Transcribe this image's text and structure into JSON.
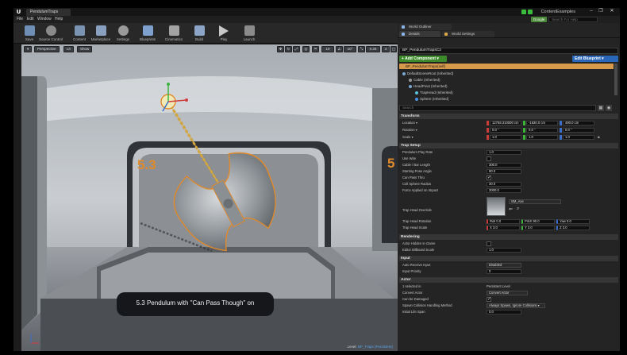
{
  "window": {
    "tab_label": "PendulumTraps",
    "project_name": "ContentExamples",
    "min": "–",
    "max": "❐",
    "close": "✕"
  },
  "menu": [
    "File",
    "Edit",
    "Window",
    "Help"
  ],
  "google_badge": "Google",
  "help_search_placeholder": "Search For Help",
  "toolbar": [
    {
      "label": "Save",
      "icon": "save-icon",
      "color": "#6f8fb7"
    },
    {
      "label": "Source Control",
      "icon": "source-control-icon",
      "color": "#8a8a8a"
    },
    {
      "label": "Content",
      "icon": "content-icon",
      "color": "#7b93b3"
    },
    {
      "label": "Marketplace",
      "icon": "marketplace-icon",
      "color": "#8aa0c0"
    },
    {
      "label": "Settings",
      "icon": "settings-icon",
      "color": "#9a9a9a"
    },
    {
      "label": "Blueprints",
      "icon": "blueprints-icon",
      "color": "#7da1cc"
    },
    {
      "label": "Cinematics",
      "icon": "cinematics-icon",
      "color": "#a3a3a3"
    },
    {
      "label": "Build",
      "icon": "build-icon",
      "color": "#8ca4c6"
    },
    {
      "label": "Play",
      "icon": "play-icon",
      "color": "#c8c8c8"
    },
    {
      "label": "Launch",
      "icon": "launch-icon",
      "color": "#8b8b8b"
    }
  ],
  "viewport": {
    "menu_button": "▾",
    "perspective": "Perspective",
    "lit": "Lit",
    "show": "Show",
    "grid_snap": "10",
    "rot_snap": "10°",
    "scale_snap": "0.25",
    "camera_speed": "4",
    "big_number_left": "5.3",
    "big_number_right": "5",
    "caption": "5.3  Pendulum with \"Can Pass Though\" on",
    "level_prefix": "Level:",
    "level_name": "BP_Traps (Persistent)"
  },
  "panels": {
    "world_outliner_tab": "World Outliner",
    "details_tab": "Details",
    "world_settings_tab": "World Settings",
    "actor_name": "BP_PendulumTrapsC2",
    "add_component": "+ Add Component ▾",
    "edit_blueprint": "Edit Blueprint ▾",
    "self_row": "BP_PendulumTraps(self)",
    "tree": [
      "DefaultSceneRoot (Inherited)",
      "Cable (Inherited)",
      "HeadPivot (Inherited)",
      "TrapHead (Inherited)",
      "Sphere (Inherited)"
    ],
    "search_placeholder": "Search"
  },
  "transform": {
    "section": "Transform",
    "location_label": "Location ▾",
    "rotation_label": "Rotation ▾",
    "scale_label": "Scale ▾",
    "location": [
      "12758.310000 cm",
      "-1630.0 cm",
      "490.0 cm"
    ],
    "rotation": [
      "0.0 °",
      "0.0 °",
      "0.0 °"
    ],
    "scale": [
      "1.0",
      "1.0",
      "1.0"
    ],
    "axis_colors": [
      "#c83c3c",
      "#3cb43c",
      "#3c6ec8"
    ]
  },
  "trap_setup": {
    "section": "Trap Setup",
    "rows": [
      {
        "label": "Pendulum Play Rate",
        "value": "1.0"
      },
      {
        "label": "Use Wire",
        "value": ""
      },
      {
        "label": "Cable / Bar Length",
        "value": "300.0"
      },
      {
        "label": "Starting Pose Angle",
        "value": "90.0"
      },
      {
        "label": "Can Pass Thru",
        "value": ""
      },
      {
        "label": "Coll Sphere Radius",
        "value": "30.0"
      },
      {
        "label": "Force Applied on Impact",
        "value": "3000.0"
      }
    ],
    "head_override_label": "Trap Head Override",
    "mesh_name": "SM_Axe",
    "head_rotation_label": "Trap Head Rotation",
    "head_rotation": [
      "Roll  0.0",
      "Pitch  90.0",
      "Yaw  0.0"
    ],
    "head_scale_label": "Trap Head Scale",
    "head_scale": [
      "X  3.0",
      "Y  3.0",
      "Z  3.0"
    ]
  },
  "rendering": {
    "section": "Rendering",
    "rows": [
      {
        "label": "Actor Hidden In Game",
        "value": ""
      },
      {
        "label": "Editor Billboard Scale",
        "value": "1.0"
      }
    ]
  },
  "input": {
    "section": "Input",
    "rows": [
      {
        "label": "Auto Receive Input",
        "value": "Disabled"
      },
      {
        "label": "Input Priority",
        "value": "0"
      }
    ]
  },
  "actor": {
    "section": "Actor",
    "rows": [
      {
        "label": "1 selected in",
        "value": "Persistent Level"
      },
      {
        "label": "Convert Actor",
        "value": "Convert Actor"
      },
      {
        "label": "Can be Damaged",
        "value": ""
      },
      {
        "label": "Spawn Collision Handling Method",
        "value": "Always Spawn, Ignore Collisions ▾"
      },
      {
        "label": "Initial Life Span",
        "value": "0.0"
      }
    ]
  }
}
